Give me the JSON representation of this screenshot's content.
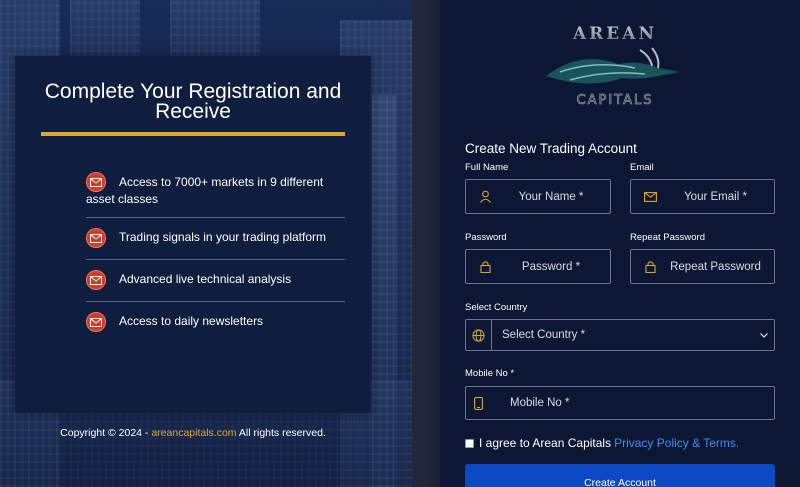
{
  "left": {
    "heading": "Complete Your Registration and Receive",
    "features": [
      {
        "icon": "mail-icon",
        "text": "Access to 7000+ markets in 9 different asset classes"
      },
      {
        "icon": "mail-icon",
        "text": "Trading signals in your trading platform"
      },
      {
        "icon": "mail-icon",
        "text": "Advanced live technical analysis"
      },
      {
        "icon": "mail-icon",
        "text": "Access to daily newsletters"
      }
    ],
    "copyright_prefix": "Copyright © 2024 -",
    "copyright_link": "areancapitals.com",
    "copyright_suffix": "All rights reserved."
  },
  "logo": {
    "top": "AREAN",
    "bottom": "CAPITALS"
  },
  "form": {
    "title": "Create New Trading Account",
    "full_name_label": "Full Name",
    "full_name_placeholder": "Your Name *",
    "email_label": "Email",
    "email_placeholder": "Your Email *",
    "password_label": "Password",
    "password_placeholder": "Password *",
    "repeat_password_label": "Repeat Password",
    "repeat_password_placeholder": "Repeat Password",
    "country_label": "Select Country",
    "country_value": "Select Country *",
    "mobile_label": "Mobile No *",
    "mobile_placeholder": "Mobile No *",
    "agree_text": "I agree to Arean Capitals",
    "agree_link": "Privacy Policy & Terms.",
    "submit_label": "Create Account"
  },
  "colors": {
    "accent": "#e0a82e",
    "icon": "#d9a53a",
    "button": "#0b49c5",
    "link": "#3b8ff0",
    "panel": "#0b1733",
    "card": "#0f1d3e",
    "feature_icon": "#cf3c2c"
  }
}
